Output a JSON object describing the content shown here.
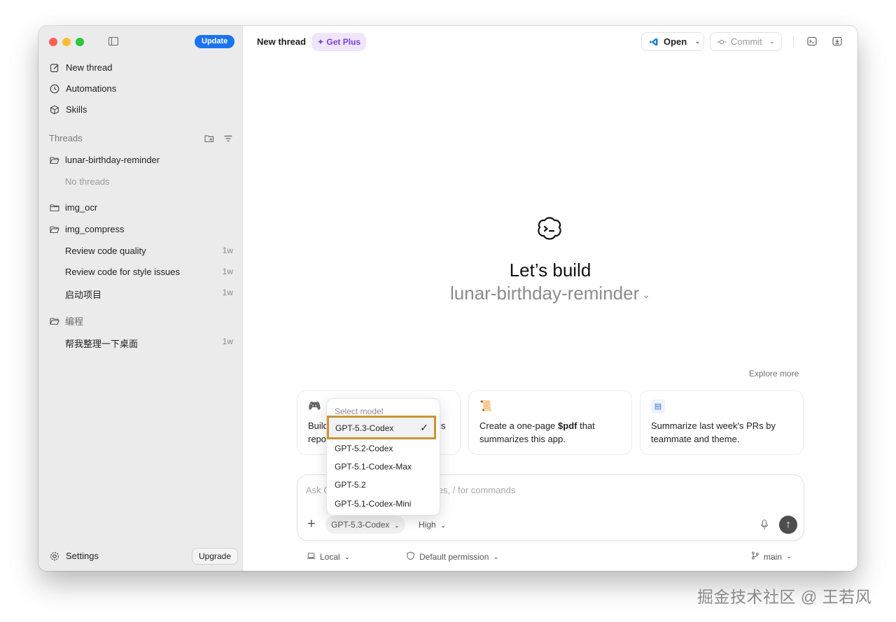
{
  "sidebar": {
    "update_label": "Update",
    "nav": [
      {
        "label": "New thread",
        "icon": "edit-icon"
      },
      {
        "label": "Automations",
        "icon": "clock-icon"
      },
      {
        "label": "Skills",
        "icon": "cube-icon"
      }
    ],
    "threads_label": "Threads",
    "folders": [
      {
        "name": "lunar-birthday-reminder",
        "empty_text": "No threads"
      },
      {
        "name": "img_ocr"
      },
      {
        "name": "img_compress",
        "threads": [
          {
            "title": "Review code quality",
            "ago": "1w"
          },
          {
            "title": "Review code for style issues",
            "ago": "1w"
          },
          {
            "title": "启动项目",
            "ago": "1w"
          }
        ]
      },
      {
        "name": "编程",
        "threads": [
          {
            "title": "帮我整理一下桌面",
            "ago": "1w"
          }
        ]
      }
    ],
    "settings_label": "Settings",
    "upgrade_label": "Upgrade"
  },
  "header": {
    "title": "New thread",
    "get_plus": "Get Plus",
    "open_label": "Open",
    "commit_label": "Commit"
  },
  "hero": {
    "title": "Let’s build",
    "project": "lunar-birthday-reminder"
  },
  "explore_more": "Explore more",
  "cards": [
    {
      "icon": "gamepad-icon",
      "text": "Build a classic Snake game in this repo."
    },
    {
      "icon": "scroll-icon",
      "text_prefix": "Create a one-page ",
      "text_bold": "$pdf",
      "text_suffix": " that summarizes this app."
    },
    {
      "icon": "newspaper-icon",
      "text": "Summarize last week's PRs by teammate and theme."
    }
  ],
  "composer": {
    "placeholder": "Ask Codex anything, @ to add files, / for commands",
    "model": "GPT-5.3-Codex",
    "effort": "High"
  },
  "footer": {
    "local": "Local",
    "permission": "Default permission",
    "branch": "main"
  },
  "model_dropdown": {
    "header": "Select model",
    "options": [
      "GPT-5.3-Codex",
      "GPT-5.2-Codex",
      "GPT-5.1-Codex-Max",
      "GPT-5.2",
      "GPT-5.1-Codex-Mini"
    ],
    "selected": "GPT-5.3-Codex",
    "check": "✓"
  },
  "watermark": "掘金技术社区 @ 王若风",
  "colors": {
    "accent": "#1a73f0",
    "plus": "#7b3fd6",
    "highlight": "#c89535"
  }
}
